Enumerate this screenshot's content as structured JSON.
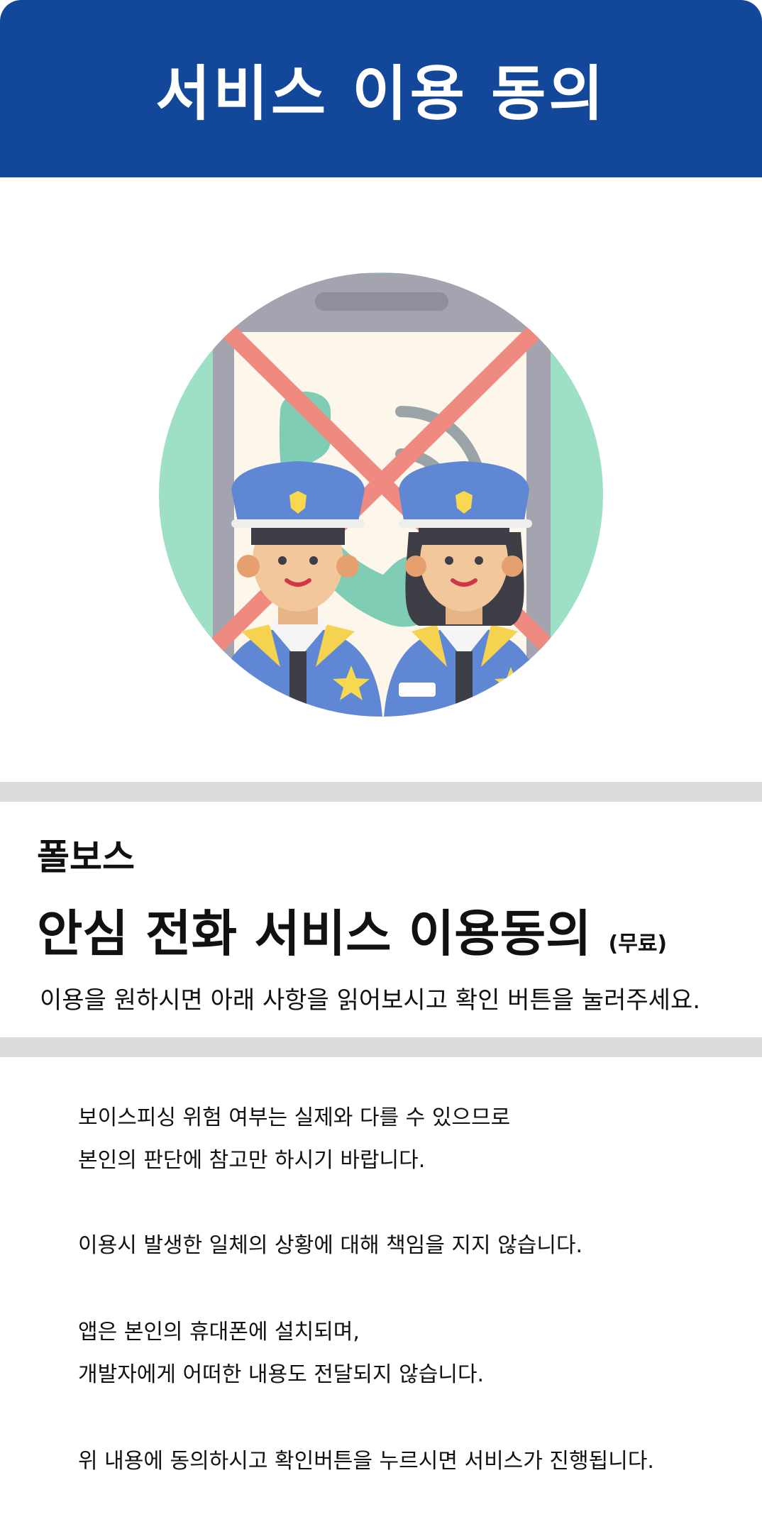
{
  "header": {
    "title": "서비스 이용 동의"
  },
  "illustration": {
    "icon_names": [
      "smartphone-icon",
      "phone-call-icon",
      "crossed-out-icon",
      "police-officer-male-icon",
      "police-officer-female-icon"
    ],
    "colors": {
      "circle": "#9ee0c6",
      "phone_body": "#a4a4b0",
      "screen": "#fdf6ea",
      "cross": "#ee8a80",
      "uniform": "#5f87d4",
      "skin": "#f2c79b"
    }
  },
  "intro": {
    "brand": "폴보스",
    "title": "안심 전화 서비스 이용동의",
    "free_tag": "(무료)",
    "subtitle": "이용을 원하시면 아래 사항을 읽어보시고 확인 버튼을 눌러주세요."
  },
  "terms": {
    "lines": [
      "보이스피싱 위험 여부는 실제와 다를 수 있으므로",
      "본인의 판단에 참고만 하시기 바랍니다.",
      "이용시 발생한 일체의 상황에 대해 책임을 지지 않습니다.",
      "앱은 본인의 휴대폰에 설치되며,",
      "개발자에게 어떠한 내용도 전달되지 않습니다.",
      "위 내용에 동의하시고 확인버튼을 누르시면 서비스가 진행됩니다."
    ]
  },
  "colors": {
    "header_bg": "#13479a",
    "divider": "#dcdcdc"
  }
}
